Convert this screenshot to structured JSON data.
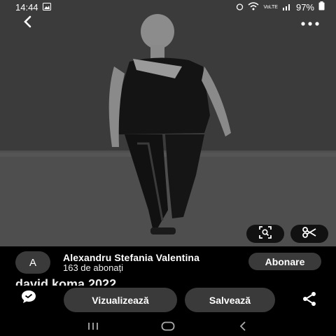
{
  "status": {
    "time": "14:44",
    "battery": "97%"
  },
  "header": {
    "back_icon": "chevron-left-icon",
    "more_icon": "more-horizontal-icon"
  },
  "image_tools": {
    "lens_icon": "visual-search-icon",
    "cut_icon": "scissors-icon"
  },
  "creator": {
    "avatar_initial": "A",
    "name": "Alexandru Stefania Valentina",
    "followers": "163 de abonați",
    "follow_label": "Abonare"
  },
  "pin": {
    "title": "david koma 2022"
  },
  "actions": {
    "view_label": "Vizualizează",
    "save_label": "Salvează",
    "comment_icon": "comment-icon",
    "share_icon": "share-icon"
  },
  "nav": {
    "recents_icon": "recents-icon",
    "home_icon": "home-icon",
    "back_icon": "back-icon"
  }
}
